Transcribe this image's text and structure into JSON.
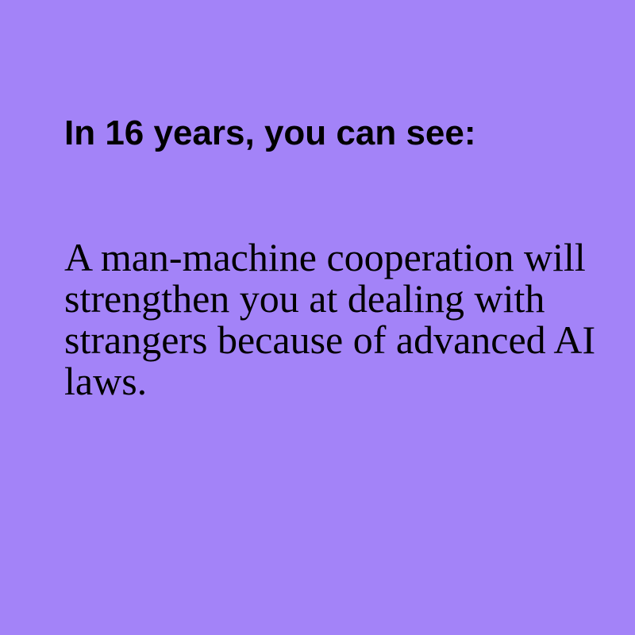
{
  "card": {
    "heading": "In 16 years, you can see:",
    "body": "A man-machine cooperation will strengthen you at dealing with strangers because of advanced AI laws.",
    "background_color": "#a383f8",
    "text_color": "#000000"
  }
}
